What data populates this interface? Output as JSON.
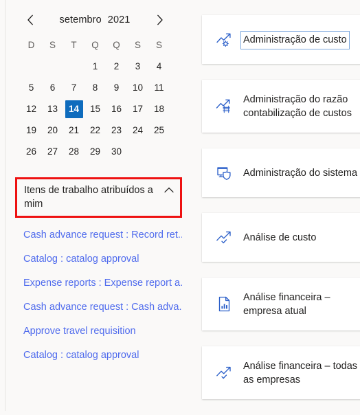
{
  "calendar": {
    "prev_label": "chevron-left",
    "next_label": "chevron-right",
    "month": "setembro",
    "year": "2021",
    "weekdays": [
      "D",
      "S",
      "T",
      "Q",
      "Q",
      "S",
      "S"
    ],
    "lead_blanks": 3,
    "days": [
      1,
      2,
      3,
      4,
      5,
      6,
      7,
      8,
      9,
      10,
      11,
      12,
      13,
      14,
      15,
      16,
      17,
      18,
      19,
      20,
      21,
      22,
      23,
      24,
      25,
      26,
      27,
      28,
      29,
      30
    ],
    "selected_day": 14,
    "selected_color": "#0f6cbd"
  },
  "work_items": {
    "section_title": "Itens de trabalho atribuídos a mim",
    "collapse_icon": "chevron-up-icon",
    "highlight_color": "#ee1111",
    "link_color": "#4f6bed",
    "links": [
      "Cash advance request : Record ret...",
      "Catalog : catalog approval",
      "Expense reports : Expense report a...",
      "Cash advance request : Cash adva...",
      "Approve travel requisition",
      "Catalog : catalog approval"
    ]
  },
  "cards": [
    {
      "label": "Administração de custo",
      "icon": "trend-gear-icon",
      "lines": 1,
      "focused": true
    },
    {
      "label": "Administração do razão\ncontabilização de custos",
      "icon": "trend-ledger-icon",
      "lines": 2,
      "focused": false
    },
    {
      "label": "Administração do sistema",
      "icon": "monitor-shield-icon",
      "lines": 1,
      "focused": false
    },
    {
      "label": "Análise de custo",
      "icon": "trend-check-icon",
      "lines": 1,
      "focused": false
    },
    {
      "label": "Análise financeira –\nempresa atual",
      "icon": "document-chart-icon",
      "lines": 2,
      "focused": false
    },
    {
      "label": "Análise financeira – todas\nas empresas",
      "icon": "trend-check-icon",
      "lines": 2,
      "focused": false
    }
  ],
  "theme": {
    "page_background": "#faf9f8",
    "card_background": "#ffffff",
    "text_color": "#201f1e",
    "icon_color": "#2b5fc9"
  }
}
